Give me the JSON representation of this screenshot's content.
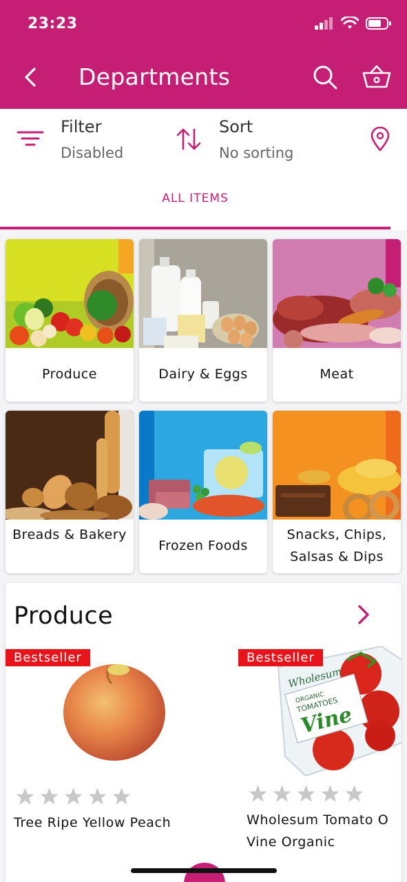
{
  "status": {
    "time": "23:23"
  },
  "header": {
    "title": "Departments"
  },
  "filter": {
    "label": "Filter",
    "value": "Disabled"
  },
  "sort": {
    "label": "Sort",
    "value": "No sorting"
  },
  "tabs": [
    {
      "label": "ALL ITEMS",
      "active": true
    }
  ],
  "departments": [
    {
      "name": "Produce"
    },
    {
      "name": "Dairy & Eggs"
    },
    {
      "name": "Meat"
    },
    {
      "name": "Breads & Bakery"
    },
    {
      "name": "Frozen Foods"
    },
    {
      "name": "Snacks, Chips, Salsas & Dips"
    }
  ],
  "produce_section": {
    "title": "Produce",
    "products": [
      {
        "badge": "Bestseller",
        "name": "Tree Ripe Yellow Peach",
        "rating": 0
      },
      {
        "badge": "Bestseller",
        "name": "Wholesum Tomato O",
        "name_line2": "Vine Organic",
        "rating": 0,
        "package_brand": "Wholesum",
        "package_lines": [
          "ORGANIC",
          "TOMATOES",
          "Vine"
        ]
      }
    ]
  },
  "colors": {
    "brand": "#c41e75",
    "badge": "#e8141b",
    "star": "#c8c8c8"
  }
}
